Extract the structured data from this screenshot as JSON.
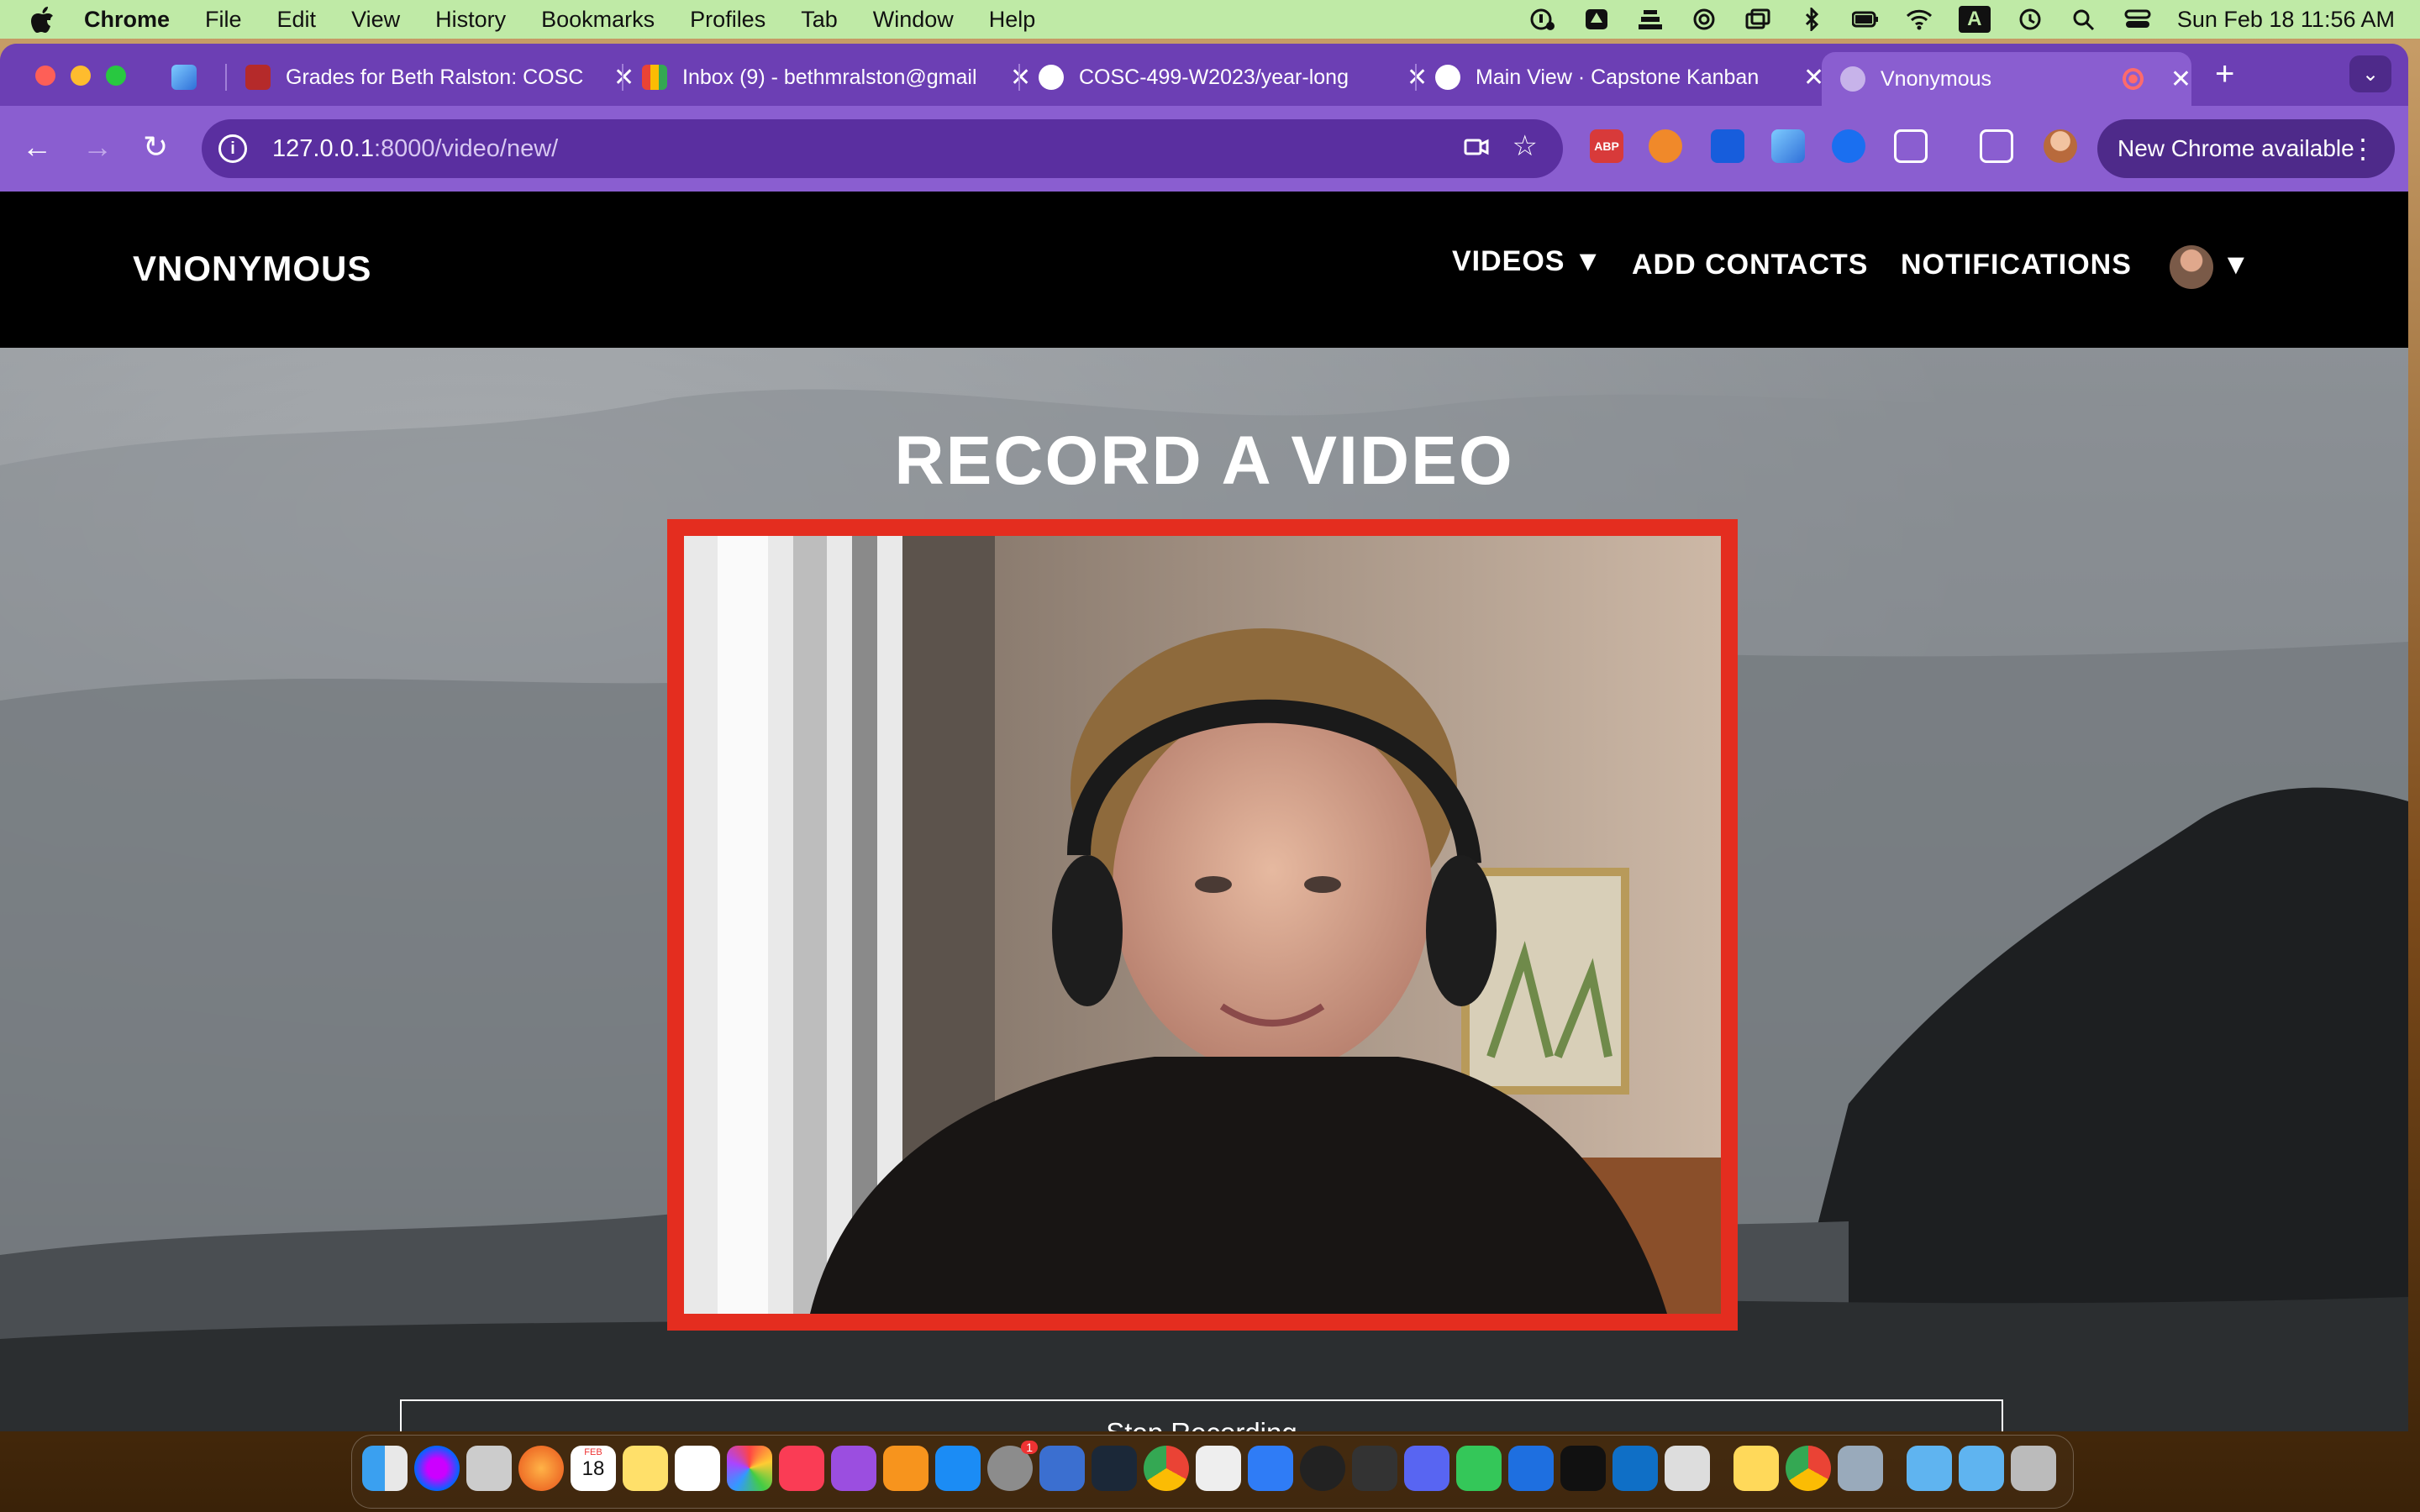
{
  "menubar": {
    "app_name": "Chrome",
    "items": [
      "File",
      "Edit",
      "View",
      "History",
      "Bookmarks",
      "Profiles",
      "Tab",
      "Window",
      "Help"
    ],
    "input_indicator": "A",
    "clock": "Sun Feb 18  11:56 AM"
  },
  "browser": {
    "tabs": [
      {
        "title": "",
        "icon": "gem-icon"
      },
      {
        "title": "Grades for Beth Ralston: COSC",
        "icon": "canvas-icon"
      },
      {
        "title": "Inbox (9) - bethmralston@gmail",
        "icon": "gmail-icon"
      },
      {
        "title": "COSC-499-W2023/year-long",
        "icon": "github-icon"
      },
      {
        "title": "Main View · Capstone Kanban",
        "icon": "github-icon"
      },
      {
        "title": "Vnonymous",
        "icon": "globe-icon",
        "active": true
      }
    ],
    "url_host": "127.0.0.1",
    "url_path": ":8000/video/new/",
    "extensions": {
      "abp": "ABP"
    },
    "new_chrome_label": "New Chrome available"
  },
  "site": {
    "brand": "VNONYMOUS",
    "nav": {
      "videos": "VIDEOS ▼",
      "add_contacts": "ADD CONTACTS",
      "notifications": "NOTIFICATIONS",
      "avatar_caret": "▼"
    },
    "page_title": "RECORD A VIDEO",
    "recording_border_color": "#e42d1f",
    "stop_button": "Stop Recording"
  },
  "calendar_badge": {
    "month": "FEB",
    "day": "18"
  },
  "dock": {
    "badge_count": "1"
  },
  "colors": {
    "tab_strip": "#6c3fb4",
    "toolbar": "#8a5ed0",
    "menubar": "#bfeaa6"
  }
}
